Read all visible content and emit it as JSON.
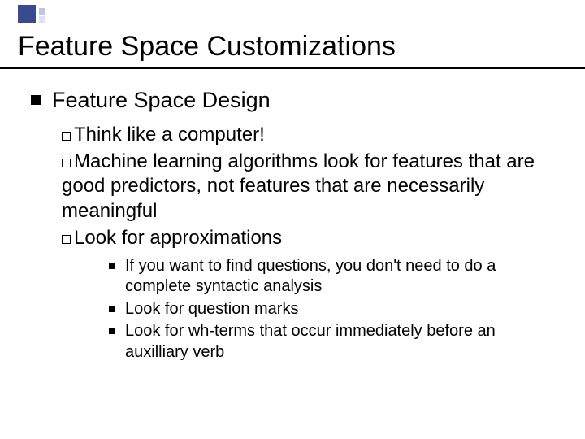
{
  "title": "Feature Space Customizations",
  "section": "Feature Space Design",
  "points": {
    "p1": "Think like a computer!",
    "p2": "Machine learning algorithms look for features that are good predictors, not features that are necessarily meaningful",
    "p3": "Look for approximations"
  },
  "subpoints": {
    "s1": "If you want to find questions, you don't need to do a complete syntactic analysis",
    "s2": "Look for question marks",
    "s3": "Look for wh-terms that occur immediately before an auxilliary verb"
  }
}
